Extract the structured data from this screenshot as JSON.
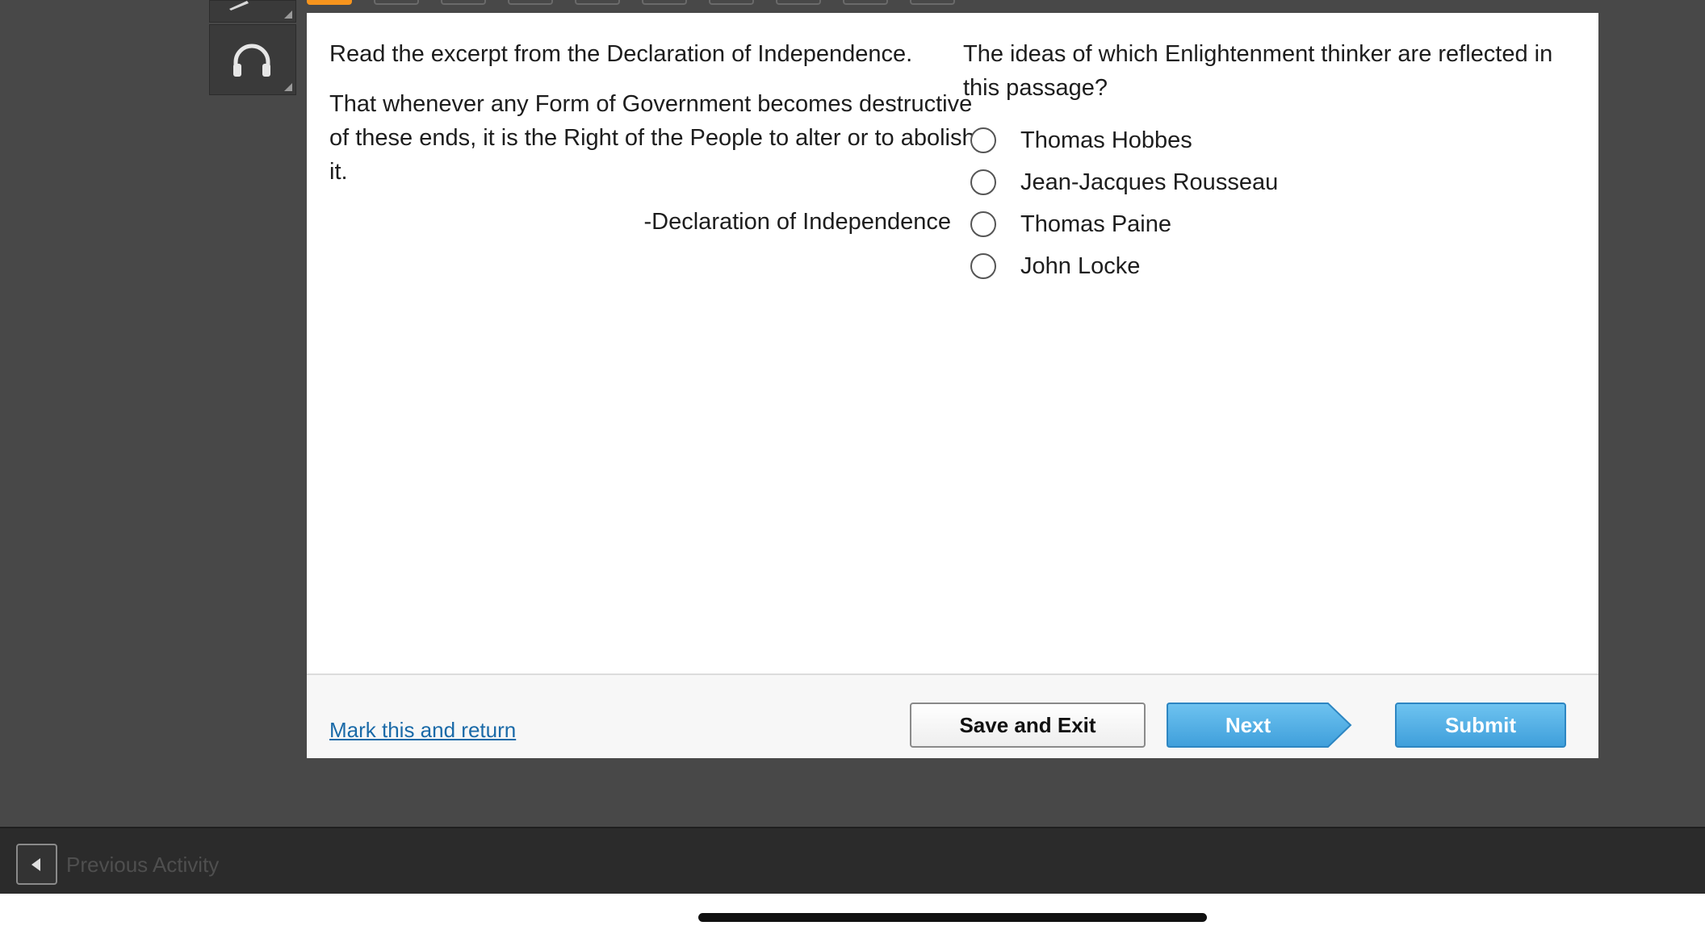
{
  "tabs": {
    "count": 10,
    "active_index": 0,
    "active_color": "#f7941d"
  },
  "tools": [
    {
      "icon": "pencil-icon"
    },
    {
      "icon": "headphones-icon"
    }
  ],
  "passage": {
    "intro": "Read the excerpt from the Declaration of Independence.",
    "excerpt": "That whenever any Form of Government becomes destructive of these ends, it is the Right of the People to alter or to abolish it.",
    "attribution": "-Declaration of Independence"
  },
  "question": {
    "prompt": "The ideas of which Enlightenment thinker are reflected in this passage?",
    "options": [
      {
        "label": "Thomas Hobbes",
        "selected": false
      },
      {
        "label": "Jean-Jacques Rousseau",
        "selected": false
      },
      {
        "label": "Thomas Paine",
        "selected": false
      },
      {
        "label": "John Locke",
        "selected": false
      }
    ]
  },
  "footer": {
    "mark_link": "Mark this and return",
    "save_label": "Save and Exit",
    "next_label": "Next",
    "submit_label": "Submit"
  },
  "bottom_bar": {
    "prev_label": "Previous Activity"
  },
  "colors": {
    "button_blue": "#4aaae3",
    "link_blue": "#1a6aa8",
    "background_dark": "#484848"
  }
}
